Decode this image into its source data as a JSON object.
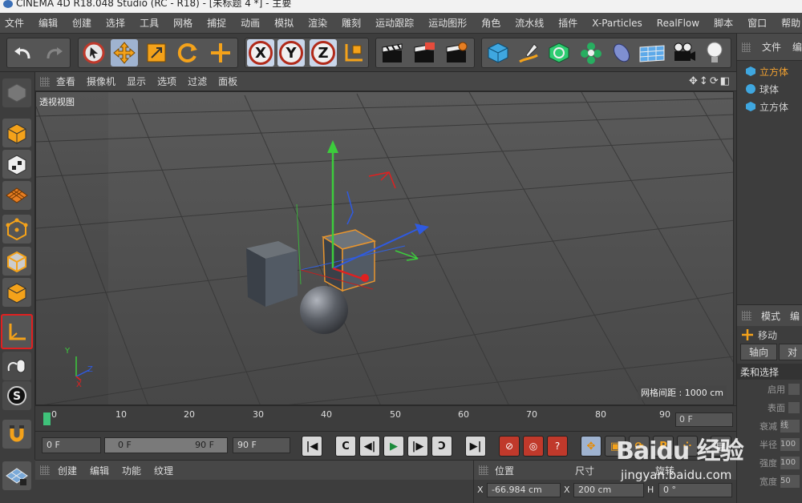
{
  "window": {
    "title": "CINEMA 4D R18.048 Studio (RC - R18) - [未标题 4 *] - 主要"
  },
  "menu": [
    "文件",
    "编辑",
    "创建",
    "选择",
    "工具",
    "网格",
    "捕捉",
    "动画",
    "模拟",
    "渲染",
    "雕刻",
    "运动跟踪",
    "运动图形",
    "角色",
    "流水线",
    "插件",
    "X-Particles",
    "RealFlow",
    "脚本",
    "窗口",
    "帮助"
  ],
  "toolbar": {
    "axis_x": "X",
    "axis_y": "Y",
    "axis_z": "Z",
    "icons": [
      "undo-icon",
      "redo-icon",
      "select-icon",
      "move-icon",
      "scale-icon",
      "rotate-icon",
      "live-select-icon",
      "x-axis-icon",
      "y-axis-icon",
      "z-axis-icon",
      "coordinate-system-icon",
      "render-view-icon",
      "render-picture-icon",
      "render-settings-icon",
      "cube-icon",
      "pen-icon",
      "subdivision-icon",
      "cloner-icon",
      "deformer-icon",
      "floor-icon",
      "camera-icon",
      "light-icon"
    ]
  },
  "viewport_menu": [
    "查看",
    "摄像机",
    "显示",
    "选项",
    "过滤",
    "面板"
  ],
  "viewport": {
    "label": "透视视图",
    "grid_spacing": "网格间距 : 1000 cm",
    "axis_labels": {
      "y": "Y",
      "z": "Z",
      "x": "X"
    }
  },
  "object_manager": {
    "tabs": [
      "文件",
      "编"
    ],
    "objects": [
      {
        "name": "立方体",
        "selected": true
      },
      {
        "name": "球体",
        "selected": false
      },
      {
        "name": "立方体",
        "selected": false
      }
    ]
  },
  "attributes": {
    "tabs": [
      "模式",
      "编"
    ],
    "tool": "移动",
    "subtabs": [
      "轴向",
      "对"
    ],
    "section": "柔和选择",
    "props": [
      {
        "label": "启用",
        "value": ""
      },
      {
        "label": "表面",
        "value": ""
      },
      {
        "label": "衰减",
        "value": "线"
      },
      {
        "label": "半径",
        "value": "100"
      },
      {
        "label": "强度",
        "value": "100"
      },
      {
        "label": "宽度",
        "value": "50"
      }
    ]
  },
  "timeline": {
    "ticks": [
      "0",
      "10",
      "20",
      "30",
      "40",
      "50",
      "60",
      "70",
      "80",
      "90"
    ],
    "current_frame_box": "0 F"
  },
  "transport": {
    "start_field": "0 F",
    "range_start": "0 F",
    "range_end": "90 F",
    "end_field": "90 F"
  },
  "material_manager": {
    "menu": [
      "创建",
      "编辑",
      "功能",
      "纹理"
    ]
  },
  "coordinates": {
    "headers": [
      "位置",
      "尺寸",
      "旋转"
    ],
    "x_label": "X",
    "pos_x": "-66.984 cm",
    "size_label": "X",
    "size_x": "200 cm",
    "rot_label": "H",
    "rot_h": "0 °"
  },
  "watermark": {
    "logo": "Baidu 经验",
    "url": "jingyan.baidu.com"
  },
  "colors": {
    "accent": "#f0a030",
    "highlight_red": "#e02020",
    "viewport_bg": "#4e4e4e",
    "panel_bg": "#3d3d3d"
  }
}
